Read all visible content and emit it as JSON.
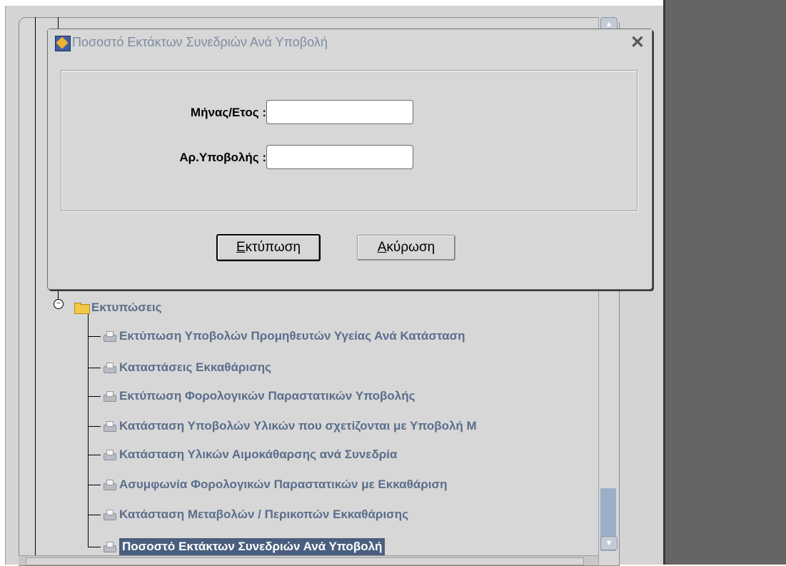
{
  "dialog": {
    "title": "Ποσοστό Εκτάκτων Συνεδριών Ανά Υποβολή",
    "close": "✕",
    "fields": [
      {
        "label": "Μήνας/Ετος :",
        "value": ""
      },
      {
        "label": "Αρ.Υποβολής :",
        "value": ""
      }
    ],
    "print_button": {
      "mnemonic": "Ε",
      "rest": "κτύπωση"
    },
    "cancel_button": {
      "mnemonic": "Α",
      "rest": "κύρωση"
    }
  },
  "tree": {
    "folder_label": "Εκτυπώσεις",
    "items": [
      {
        "label": "Εκτύπωση Υποβολών Προμηθευτών Υγείας Ανά Κατάσταση"
      },
      {
        "label": "Καταστάσεις Εκκαθάρισης"
      },
      {
        "label": "Εκτύπωση Φορολογικών Παραστατικών Υποβολής"
      },
      {
        "label": "Κατάσταση Υποβολών Υλικών που σχετίζονται με Υποβολή Μ"
      },
      {
        "label": "Κατάσταση Υλικών Αιμοκάθαρσης ανά Συνεδρία"
      },
      {
        "label": "Ασυμφωνία Φορολογικών Παραστατικών με Εκκαθάριση"
      },
      {
        "label": "Κατάσταση Μεταβολών / Περικοπών Εκκαθάρισης"
      },
      {
        "label": "Ποσοστό Εκτάκτων Συνεδριών Ανά Υποβολή",
        "selected": true
      }
    ]
  },
  "colors": {
    "tree_text": "#5a6e8c",
    "selection": "#4a5f7e",
    "right_panel": "#656565"
  }
}
